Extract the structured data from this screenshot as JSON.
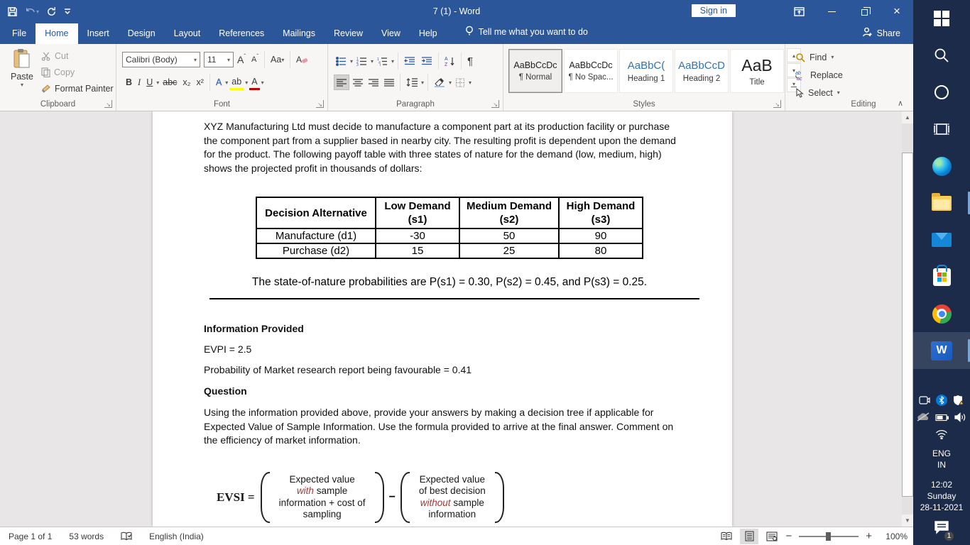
{
  "titlebar": {
    "title": "7 (1)  -  Word",
    "sign_in": "Sign in"
  },
  "tabs": {
    "items": [
      {
        "label": "File",
        "active": false
      },
      {
        "label": "Home",
        "active": true
      },
      {
        "label": "Insert",
        "active": false
      },
      {
        "label": "Design",
        "active": false
      },
      {
        "label": "Layout",
        "active": false
      },
      {
        "label": "References",
        "active": false
      },
      {
        "label": "Mailings",
        "active": false
      },
      {
        "label": "Review",
        "active": false
      },
      {
        "label": "View",
        "active": false
      },
      {
        "label": "Help",
        "active": false
      }
    ],
    "tell_me": "Tell me what you want to do",
    "share": "Share"
  },
  "ribbon": {
    "clipboard": {
      "label": "Clipboard",
      "paste": "Paste",
      "cut": "Cut",
      "copy": "Copy",
      "format_painter": "Format Painter"
    },
    "font": {
      "label": "Font",
      "family": "Calibri (Body)",
      "size": "11",
      "bold": "B",
      "italic": "I",
      "underline": "U",
      "strike": "abc",
      "subscript": "x₂",
      "superscript": "x²",
      "change_case": "Aa",
      "grow": "A",
      "shrink": "A",
      "effects": "A",
      "highlight": "ab",
      "color": "A"
    },
    "paragraph": {
      "label": "Paragraph"
    },
    "styles": {
      "label": "Styles",
      "items": [
        {
          "preview": "AaBbCcDc",
          "name": "¶ Normal"
        },
        {
          "preview": "AaBbCcDc",
          "name": "¶ No Spac..."
        },
        {
          "preview": "AaBbC(",
          "name": "Heading 1"
        },
        {
          "preview": "AaBbCcD",
          "name": "Heading 2"
        },
        {
          "preview": "AaB",
          "name": "Title"
        }
      ]
    },
    "editing": {
      "label": "Editing",
      "find": "Find",
      "replace": "Replace",
      "select": "Select"
    }
  },
  "document": {
    "para1": "XYZ Manufacturing Ltd must decide to manufacture a component part at its production facility or purchase the component part from a supplier based in nearby city. The resulting profit is dependent upon the demand for the product. The following payoff table with three states of nature for the demand (low, medium, high) shows the projected profit in thousands of dollars:",
    "payoff_table": {
      "headers": [
        "Decision Alternative",
        "Low Demand\n(s1)",
        "Medium Demand\n(s2)",
        "High Demand\n(s3)"
      ],
      "rows": [
        [
          "Manufacture (d1)",
          "-30",
          "50",
          "90"
        ],
        [
          "Purchase (d2)",
          "15",
          "25",
          "80"
        ]
      ]
    },
    "prob_line": "The state-of-nature probabilities are P(s1) = 0.30, P(s2) = 0.45, and P(s3) = 0.25.",
    "info_heading": "Information Provided",
    "evpi_line": "EVPI = 2.5",
    "prob_fav_line": "Probability of Market research report being favourable = 0.41",
    "question_heading": "Question",
    "question_text": "Using the information provided above, provide your answers by making a decision tree if applicable for Expected Value of Sample Information. Use the formula provided to arrive at the final answer. Comment on the efficiency of market information.",
    "formula": {
      "lhs": "EVSI =",
      "minus": "−",
      "left": {
        "l1": "Expected value",
        "l2_red": "with",
        "l2_rest": " sample",
        "l3": "information + cost of",
        "l4": "sampling"
      },
      "right": {
        "r1": "Expected value",
        "r2": "of best decision",
        "r3_red": "without",
        "r3_rest": " sample",
        "r4": "information"
      }
    }
  },
  "statusbar": {
    "page": "Page 1 of 1",
    "words": "53 words",
    "language": "English (India)",
    "zoom": "100%"
  },
  "taskbar": {
    "lang1": "ENG",
    "lang2": "IN",
    "time": "12:02",
    "day": "Sunday",
    "date": "28-11-2021",
    "badge": "1"
  },
  "colors": {
    "accent": "#2b579a",
    "taskbar_bg": "#1c2b4a",
    "heading_blue": "#2e74b5",
    "formula_red": "#9e3a36",
    "highlight_yellow": "#ffff00",
    "font_color_red": "#c00000"
  }
}
